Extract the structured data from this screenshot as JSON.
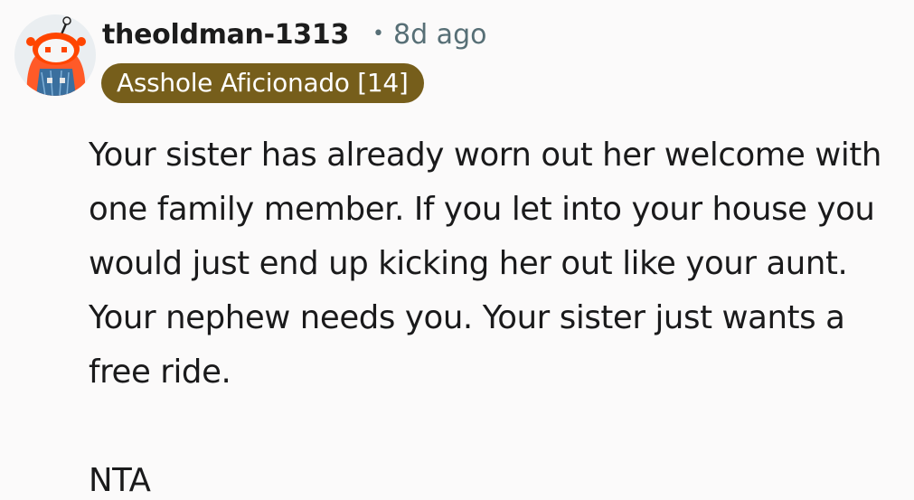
{
  "comment": {
    "author": {
      "username": "theoldman-1313",
      "avatar_icon": "snoo-avatar-icon",
      "flair": "Asshole Aficionado [14]",
      "flair_color": "#765e1b"
    },
    "separator": "•",
    "timestamp": "8d ago",
    "body": {
      "paragraph_1": "Your sister has already worn out her welcome with one family member. If you let into your house you would just end up kicking her out like your aunt. Your nephew needs you. Your sister just wants a free ride.",
      "paragraph_2": "NTA"
    }
  }
}
